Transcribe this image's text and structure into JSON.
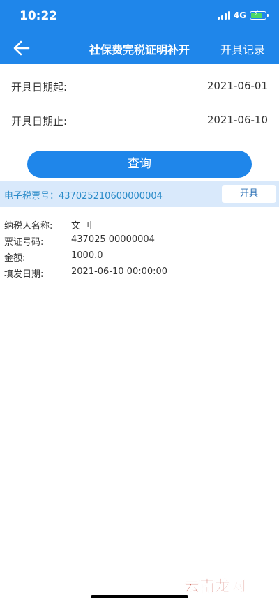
{
  "status_bar": {
    "time": "10:22",
    "network": "4G"
  },
  "nav": {
    "title": "社保费完税证明补开",
    "action": "开具记录"
  },
  "form": {
    "start_label": "开具日期起:",
    "start_value": "2021-06-01",
    "end_label": "开具日期止:",
    "end_value": "2021-06-10"
  },
  "query_label": "查询",
  "ticket": {
    "label": "电子税票号：437025210600000004",
    "issue_label": "开具"
  },
  "details": [
    {
      "key": "纳税人名称:",
      "value": "文 刂"
    },
    {
      "key": "票证号码:",
      "value": "437025 00000004"
    },
    {
      "key": "金额:",
      "value": "1000.0"
    },
    {
      "key": "填发日期:",
      "value": "2021-06-10 00:00:00"
    }
  ],
  "watermark": "云南龙网",
  "colors": {
    "primary": "#1f86ea",
    "ticket_bg": "#d9e9fb",
    "ticket_text": "#2a8bc9",
    "watermark": "#c0392b"
  },
  "icons": {
    "back": "arrow-left-icon",
    "battery": "battery-charging-icon",
    "signal": "signal-bars-icon"
  }
}
